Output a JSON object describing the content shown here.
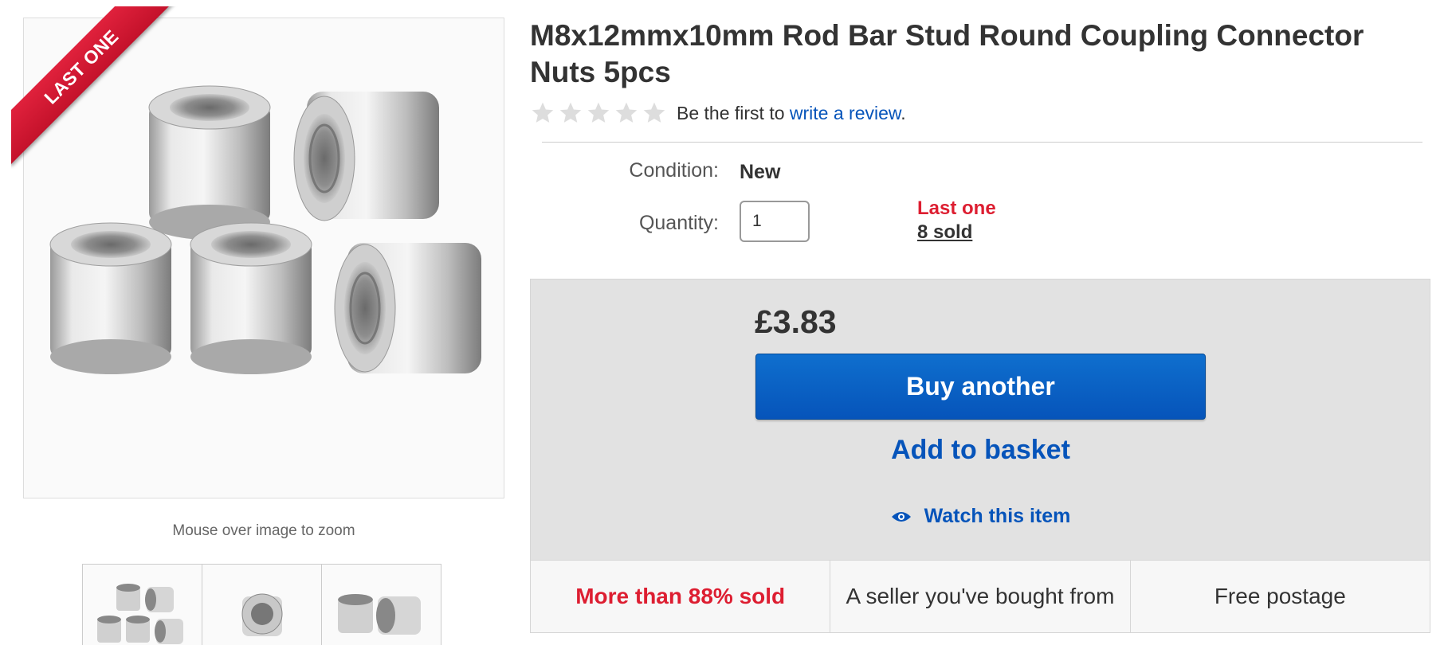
{
  "gallery": {
    "ribbon": "LAST ONE",
    "zoom_hint": "Mouse over image to zoom",
    "thumbnails": [
      "thumbnail-nuts-group",
      "thumbnail-nut-single",
      "thumbnail-nuts-pair"
    ]
  },
  "product": {
    "title": "M8x12mmx10mm Rod Bar Stud Round Coupling Connector Nuts 5pcs",
    "rating": {
      "stars_filled": 0,
      "stars_total": 5,
      "prefix": "Be the first to ",
      "link": "write a review",
      "suffix": "."
    },
    "condition_label": "Condition:",
    "condition_value": "New",
    "quantity_label": "Quantity:",
    "quantity_value": "1",
    "availability": "Last one",
    "sold": "8 sold"
  },
  "purchase": {
    "price": "£3.83",
    "buy_label": "Buy another",
    "basket_label": "Add to basket",
    "watch_label": "Watch this item"
  },
  "badges": [
    {
      "text": "More than 88% sold",
      "style": "hot"
    },
    {
      "text": "A seller you've bought from",
      "style": "normal"
    },
    {
      "text": "Free postage",
      "style": "normal"
    }
  ],
  "colors": {
    "link_blue": "#0654ba",
    "alert_red": "#dd1e31",
    "panel_grey": "#e2e2e2"
  },
  "icons": {
    "star": "star-outline-icon",
    "watch": "eye-icon"
  }
}
